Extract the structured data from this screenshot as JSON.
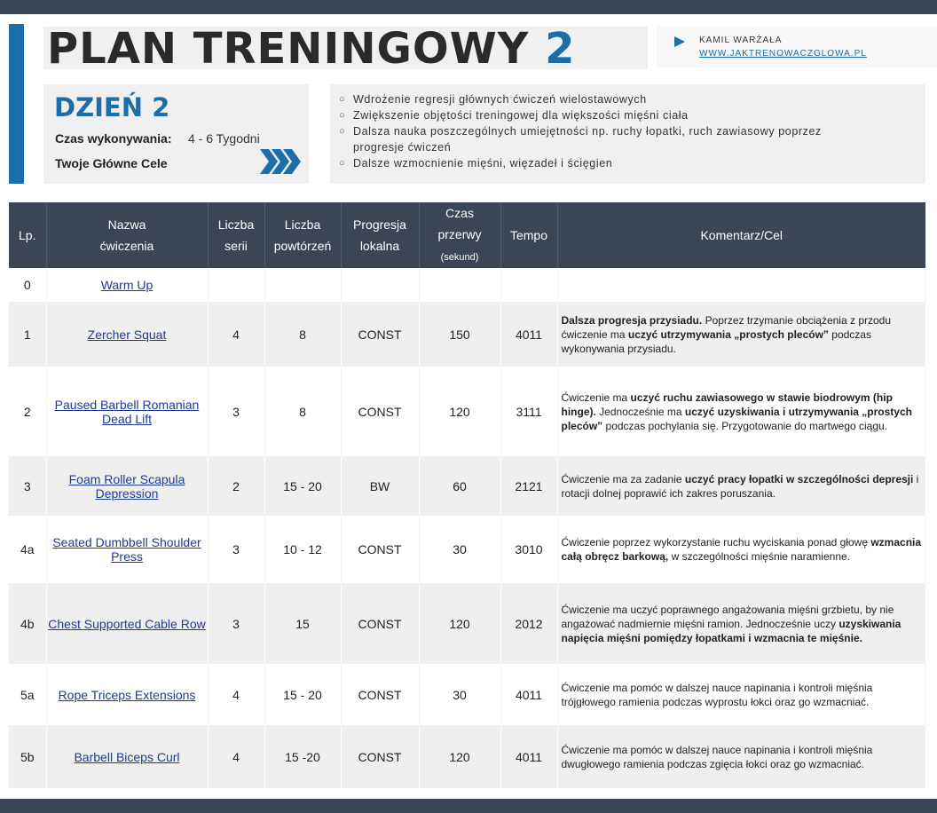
{
  "header": {
    "title": "PLAN TRENINGOWY",
    "title_number": "2",
    "author_name": "KAMIL WARŻAŁA",
    "author_link": "WWW.JAKTRENOWACZGLOWA.PL"
  },
  "day": {
    "title": "DZIEŃ 2",
    "time_label": "Czas wykonywania:",
    "time_value": "4 - 6 Tygodni",
    "goals_label": "Twoje Główne Cele"
  },
  "goals": [
    "Wdrożenie regresji głównych ćwiczeń wielostawowych",
    "Zwiększenie objętości treningowej dla większości mięśni ciała",
    "Dalsza nauka poszczególnych umiejętności np. ruchy łopatki, ruch zawiasowy poprzez progresje ćwiczeń",
    "Dalsze wzmocnienie mięśni, więzadeł i ścięgien"
  ],
  "table": {
    "headers": {
      "lp": "Lp.",
      "name_1": "Nazwa",
      "name_2": "ćwiczenia",
      "sets_1": "Liczba",
      "sets_2": "serii",
      "reps_1": "Liczba",
      "reps_2": "powtórzeń",
      "prog_1": "Progresja",
      "prog_2": "lokalna",
      "rest_1": "Czas",
      "rest_2": "przerwy",
      "rest_3": "(sekund)",
      "tempo": "Tempo",
      "comment": "Komentarz/Cel"
    },
    "rows": [
      {
        "lp": "0",
        "name": "Warm Up",
        "sets": "",
        "reps": "",
        "prog": "",
        "rest": "",
        "tempo": ""
      },
      {
        "lp": "1",
        "name": "Zercher Squat",
        "sets": "4",
        "reps": "8",
        "prog": "CONST",
        "rest": "150",
        "tempo": "4011",
        "c1": "Dalsza progresja przysiadu.",
        "c2": " Poprzez trzymanie obciążenia z przodu ćwiczenie ma ",
        "c3": "uczyć utrzymywania „prostych pleców”",
        "c4": " podczas wykonywania przysiadu."
      },
      {
        "lp": "2",
        "name": "Paused Barbell Romanian Dead Lift",
        "sets": "3",
        "reps": "8",
        "prog": "CONST",
        "rest": "120",
        "tempo": "3111",
        "c1": "Ćwiczenie ma ",
        "c2": "uczyć ruchu zawiasowego w stawie biodrowym (hip hinge).",
        "c3": " Jednocześnie ma ",
        "c4": "uczyć uzyskiwania i utrzymywania „prostych pleców”",
        "c5": " podczas pochylania się. Przygotowanie do martwego ciągu."
      },
      {
        "lp": "3",
        "name": "Foam Roller Scapula Depression",
        "sets": "2",
        "reps": "15 - 20",
        "prog": "BW",
        "rest": "60",
        "tempo": "2121",
        "c1": "Ćwiczenie ma za zadanie ",
        "c2": "uczyć pracy łopatki w szczególności depresji",
        "c3": " i rotacji dolnej poprawić ich zakres poruszania."
      },
      {
        "lp": "4a",
        "name": "Seated Dumbbell Shoulder Press",
        "sets": "3",
        "reps": "10 - 12",
        "prog": "CONST",
        "rest": "30",
        "tempo": "3010",
        "c1": "Ćwiczenie poprzez wykorzystanie ruchu wyciskania ponad głowę ",
        "c2": "wzmacnia całą obręcz barkową,",
        "c3": " w szczególności mięśnie naramienne."
      },
      {
        "lp": "4b",
        "name": "Chest Supported Cable Row",
        "sets": "3",
        "reps": "15",
        "prog": "CONST",
        "rest": "120",
        "tempo": "2012",
        "c1": "Ćwiczenie ma uczyć poprawnego angażowania mięśni grzbietu, by nie angażować nadmiernie mięśni ramion. Jednocześnie uczy ",
        "c2": "uzyskiwania napięcia mięśni pomiędzy łopatkami i wzmacnia te mięśnie."
      },
      {
        "lp": "5a",
        "name": "Rope Triceps Extensions",
        "sets": "4",
        "reps": "15 - 20",
        "prog": "CONST",
        "rest": "30",
        "tempo": "4011",
        "c1": "Ćwiczenie ma pomóc w dalszej nauce napinania i kontroli mięśnia trójgłowego ramienia podczas wyprostu łokci oraz go wzmacniać."
      },
      {
        "lp": "5b",
        "name": "Barbell Biceps Curl",
        "sets": "4",
        "reps": "15 -20",
        "prog": "CONST",
        "rest": "120",
        "tempo": "4011",
        "c1": "Ćwiczenie ma pomóc w dalszej nauce napinania i kontroli mięśnia dwugłowego ramienia podczas zgięcia łokci oraz go wzmacniać."
      }
    ]
  },
  "colors": {
    "accent": "#1b6ea8",
    "header_bg": "#3b4553",
    "row_alt_bg": "#efefef",
    "link": "#1f3a93"
  }
}
